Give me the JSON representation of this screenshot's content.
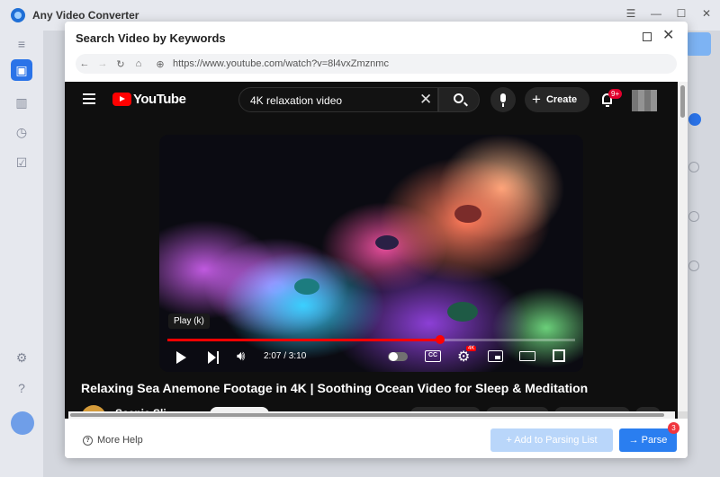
{
  "app": {
    "title": "Any Video Converter",
    "accent": "#2a73e8"
  },
  "dialog": {
    "title": "Search Video by Keywords",
    "url": "https://www.youtube.com/watch?v=8l4vxZmznmc"
  },
  "youtube": {
    "logo_text": "YouTube",
    "search_value": "4K relaxation video",
    "create_label": "Create",
    "notification_badge": "9+",
    "player": {
      "tooltip": "Play (k)",
      "time": "2:07 / 3:10",
      "progress_fraction": 0.668,
      "quality_badge": "4K",
      "cc_label": "CC"
    },
    "video_title": "Relaxing Sea Anemone Footage in 4K | Soothing Ocean Video for Sleep & Meditation",
    "channel_name": "Scenic Sli..."
  },
  "footer": {
    "help_label": "More Help",
    "add_label": "+ Add to Parsing List",
    "parse_label": "→ Parse",
    "parse_badge": "3"
  }
}
